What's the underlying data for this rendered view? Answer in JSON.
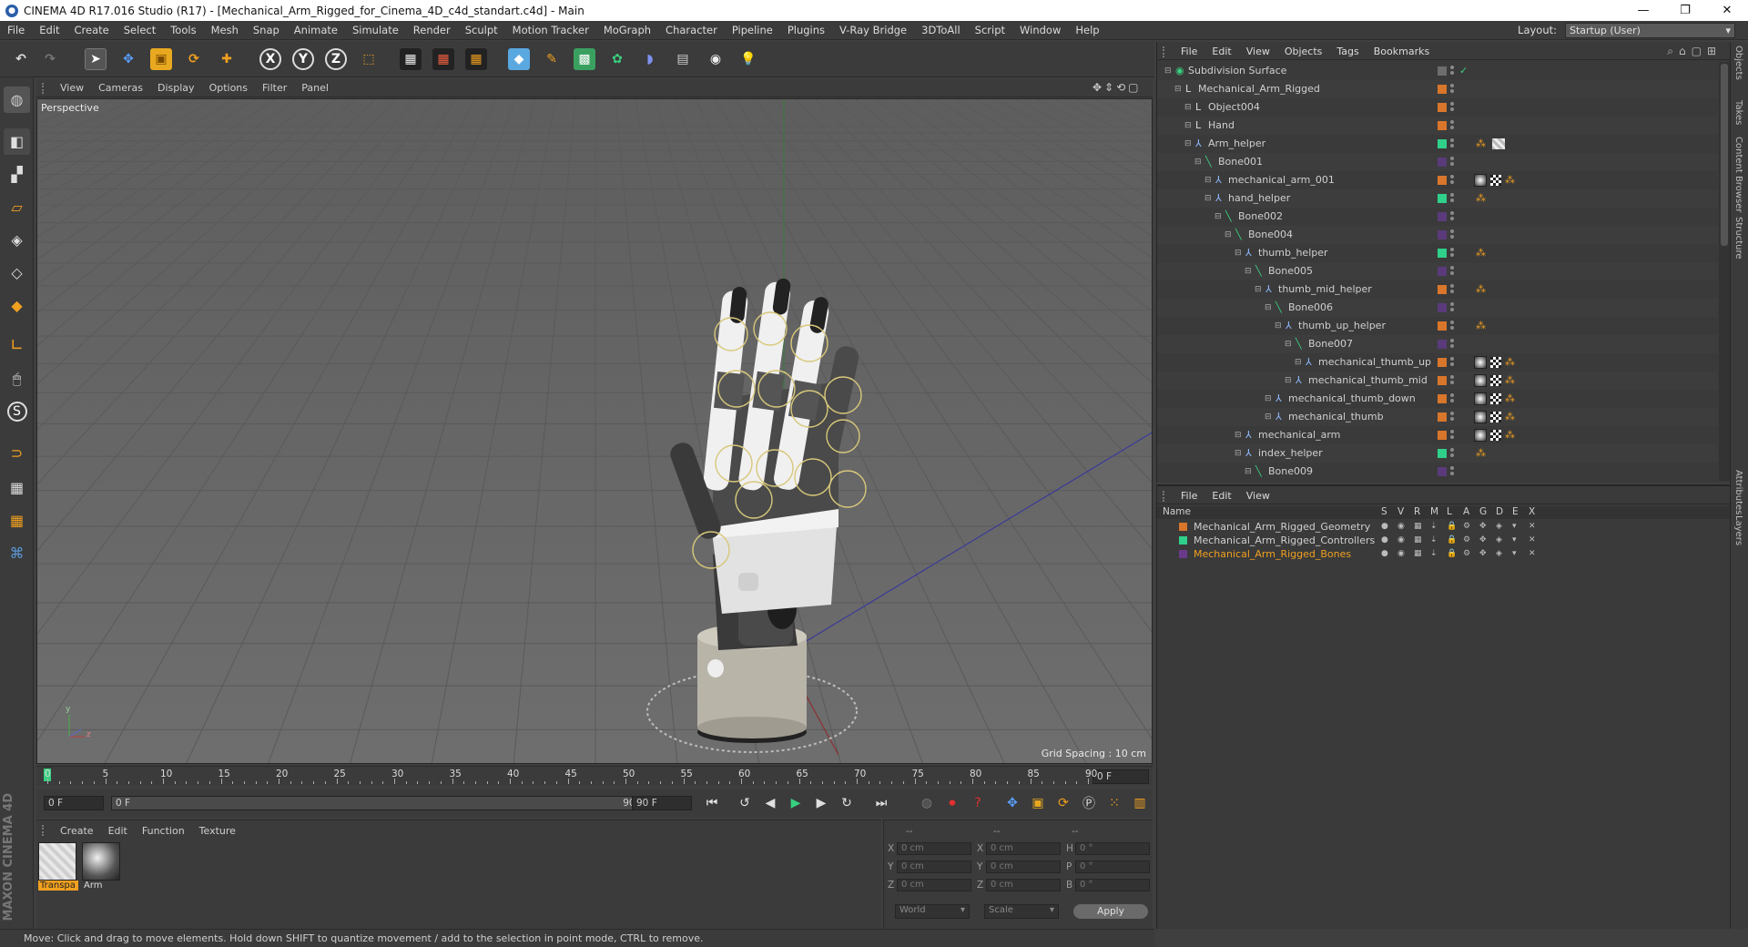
{
  "window": {
    "title": "CINEMA 4D R17.016 Studio (R17) - [Mechanical_Arm_Rigged_for_Cinema_4D_c4d_standart.c4d] - Main",
    "minimize": "—",
    "maximize": "❐",
    "close": "✕"
  },
  "menu": [
    "File",
    "Edit",
    "Create",
    "Select",
    "Tools",
    "Mesh",
    "Snap",
    "Animate",
    "Simulate",
    "Render",
    "Sculpt",
    "Motion Tracker",
    "MoGraph",
    "Character",
    "Pipeline",
    "Plugins",
    "V-Ray Bridge",
    "3DToAll",
    "Script",
    "Window",
    "Help"
  ],
  "layout": {
    "label": "Layout:",
    "value": "Startup (User)"
  },
  "viewport": {
    "menu": [
      "View",
      "Cameras",
      "Display",
      "Options",
      "Filter",
      "Panel"
    ],
    "label": "Perspective",
    "grid_spacing": "Grid Spacing : 10 cm"
  },
  "timeline": {
    "ticks": [
      "0",
      "5",
      "10",
      "15",
      "20",
      "25",
      "30",
      "35",
      "40",
      "45",
      "50",
      "55",
      "60",
      "65",
      "70",
      "75",
      "80",
      "85",
      "90"
    ],
    "current": "0 F"
  },
  "transport": {
    "start": "0 F",
    "range_start": "0 F",
    "range_end": "90 F",
    "end": "90 F"
  },
  "materials": {
    "menu": [
      "Create",
      "Edit",
      "Function",
      "Texture"
    ],
    "items": [
      "Transpa",
      "Arm"
    ]
  },
  "coords": {
    "headers": [
      "--",
      "--",
      "--"
    ],
    "rows": [
      {
        "a": "X",
        "av": "0 cm",
        "b": "X",
        "bv": "0 cm",
        "c": "H",
        "cv": "0 °"
      },
      {
        "a": "Y",
        "av": "0 cm",
        "b": "Y",
        "bv": "0 cm",
        "c": "P",
        "cv": "0 °"
      },
      {
        "a": "Z",
        "av": "0 cm",
        "b": "Z",
        "bv": "0 cm",
        "c": "B",
        "cv": "0 °"
      }
    ],
    "world": "World",
    "scale": "Scale",
    "apply": "Apply"
  },
  "status": "Move: Click and drag to move elements. Hold down SHIFT to quantize movement / add to the selection in point mode, CTRL to remove.",
  "objects": {
    "menu": [
      "File",
      "Edit",
      "View",
      "Objects",
      "Tags",
      "Bookmarks"
    ],
    "tree": [
      {
        "name": "Subdivision Surface",
        "indent": 0,
        "color": "#6d6d6d",
        "icon": "subdiv"
      },
      {
        "name": "Mechanical_Arm_Rigged",
        "indent": 1,
        "color": "#d8762b",
        "icon": "null"
      },
      {
        "name": "Object004",
        "indent": 2,
        "color": "#d8762b",
        "icon": "null"
      },
      {
        "name": "Hand",
        "indent": 2,
        "color": "#d8762b",
        "icon": "null"
      },
      {
        "name": "Arm_helper",
        "indent": 2,
        "color": "#2fd08a",
        "icon": "joint"
      },
      {
        "name": "Bone001",
        "indent": 3,
        "color": "#5a3a7a",
        "icon": "bone"
      },
      {
        "name": "mechanical_arm_001",
        "indent": 4,
        "color": "#d8762b",
        "icon": "joint"
      },
      {
        "name": "hand_helper",
        "indent": 4,
        "color": "#2fd08a",
        "icon": "joint"
      },
      {
        "name": "Bone002",
        "indent": 5,
        "color": "#5a3a7a",
        "icon": "bone"
      },
      {
        "name": "Bone004",
        "indent": 6,
        "color": "#5a3a7a",
        "icon": "bone"
      },
      {
        "name": "thumb_helper",
        "indent": 7,
        "color": "#2fd08a",
        "icon": "joint"
      },
      {
        "name": "Bone005",
        "indent": 8,
        "color": "#5a3a7a",
        "icon": "bone"
      },
      {
        "name": "thumb_mid_helper",
        "indent": 9,
        "color": "#d8762b",
        "icon": "joint"
      },
      {
        "name": "Bone006",
        "indent": 10,
        "color": "#5a3a7a",
        "icon": "bone"
      },
      {
        "name": "thumb_up_helper",
        "indent": 11,
        "color": "#d8762b",
        "icon": "joint"
      },
      {
        "name": "Bone007",
        "indent": 12,
        "color": "#5a3a7a",
        "icon": "bone"
      },
      {
        "name": "mechanical_thumb_up",
        "indent": 13,
        "color": "#d8762b",
        "icon": "joint"
      },
      {
        "name": "mechanical_thumb_mid",
        "indent": 12,
        "color": "#d8762b",
        "icon": "joint"
      },
      {
        "name": "mechanical_thumb_down",
        "indent": 10,
        "color": "#d8762b",
        "icon": "joint"
      },
      {
        "name": "mechanical_thumb",
        "indent": 10,
        "color": "#d8762b",
        "icon": "joint"
      },
      {
        "name": "mechanical_arm",
        "indent": 7,
        "color": "#d8762b",
        "icon": "joint"
      },
      {
        "name": "index_helper",
        "indent": 7,
        "color": "#2fd08a",
        "icon": "joint"
      },
      {
        "name": "Bone009",
        "indent": 8,
        "color": "#5a3a7a",
        "icon": "bone"
      }
    ]
  },
  "layers": {
    "menu": [
      "File",
      "Edit",
      "View"
    ],
    "header": [
      "Name",
      "S",
      "V",
      "R",
      "M",
      "L",
      "A",
      "G",
      "D",
      "E",
      "X"
    ],
    "rows": [
      {
        "name": "Mechanical_Arm_Rigged_Geometry",
        "color": "#d8762b",
        "selected": false
      },
      {
        "name": "Mechanical_Arm_Rigged_Controllers",
        "color": "#2fd08a",
        "selected": false
      },
      {
        "name": "Mechanical_Arm_Rigged_Bones",
        "color": "#6a3a8a",
        "selected": true
      }
    ]
  },
  "side_tabs": [
    "Objects",
    "Takes",
    "Content Browser",
    "Structure",
    "Attributes",
    "Layers"
  ],
  "brand": "MAXON CINEMA 4D"
}
